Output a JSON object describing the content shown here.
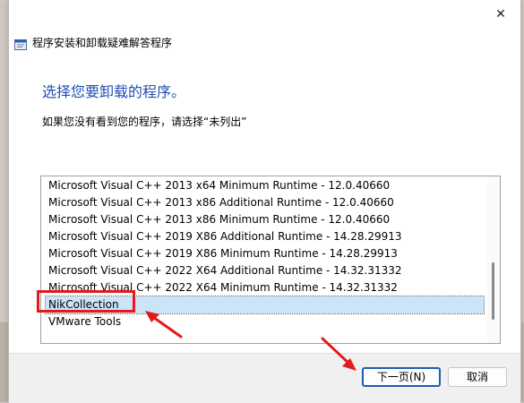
{
  "window": {
    "title": "程序安装和卸载疑难解答程序",
    "close_glyph": "✕"
  },
  "content": {
    "heading": "选择您要卸载的程序。",
    "instruction": "如果您没有看到您的程序，请选择“未列出”"
  },
  "program_list": {
    "items": [
      {
        "label": "Microsoft Visual C++ 2013 x64 Minimum Runtime - 12.0.40660"
      },
      {
        "label": "Microsoft Visual C++ 2013 x86 Additional Runtime - 12.0.40660"
      },
      {
        "label": "Microsoft Visual C++ 2013 x86 Minimum Runtime - 12.0.40660"
      },
      {
        "label": "Microsoft Visual C++ 2019 X86 Additional Runtime - 14.28.29913"
      },
      {
        "label": "Microsoft Visual C++ 2019 X86 Minimum Runtime - 14.28.29913"
      },
      {
        "label": "Microsoft Visual C++ 2022 X64 Additional Runtime - 14.32.31332"
      },
      {
        "label": "Microsoft Visual C++ 2022 X64 Minimum Runtime - 14.32.31332"
      },
      {
        "label": "NikCollection",
        "selected": true
      },
      {
        "label": "VMware Tools"
      }
    ]
  },
  "buttons": {
    "next_label": "下一页(N)",
    "cancel_label": "取消"
  },
  "colors": {
    "heading": "#1f4eb4",
    "selection": "#cce4f7",
    "annotation_red": "#e11b1b",
    "default_button_border": "#1a5fb4"
  }
}
